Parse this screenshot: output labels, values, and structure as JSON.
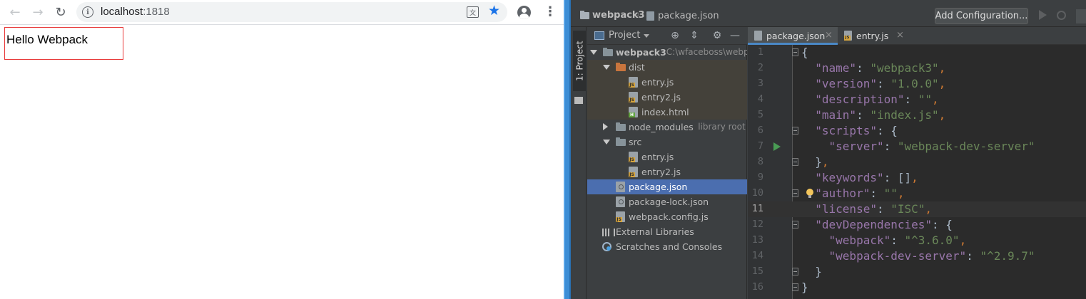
{
  "browser": {
    "url_host": "localhost",
    "url_port": ":1818",
    "page_text": "Hello Webpack"
  },
  "ide": {
    "breadcrumb_project": "webpack3",
    "breadcrumb_file": "package.json",
    "add_configuration_label": "Add Configuration...",
    "side_tab_label": "1: Project",
    "project_panel_title": "Project",
    "tree": [
      {
        "label": "webpack3",
        "hint": "C:\\wfaceboss\\webpa",
        "icon": "folder-icon",
        "indent": 0,
        "arrow": "open",
        "bold": true
      },
      {
        "label": "dist",
        "hint": "",
        "icon": "folder-icon-orange",
        "indent": 1,
        "arrow": "open"
      },
      {
        "label": "entry.js",
        "hint": "",
        "icon": "js-file-icon",
        "indent": 2,
        "arrow": ""
      },
      {
        "label": "entry2.js",
        "hint": "",
        "icon": "js-file-icon",
        "indent": 2,
        "arrow": ""
      },
      {
        "label": "index.html",
        "hint": "",
        "icon": "html-file-icon",
        "indent": 2,
        "arrow": ""
      },
      {
        "label": "node_modules",
        "hint": "library root",
        "icon": "folder-icon",
        "indent": 1,
        "arrow": "closed"
      },
      {
        "label": "src",
        "hint": "",
        "icon": "folder-icon",
        "indent": 1,
        "arrow": "open"
      },
      {
        "label": "entry.js",
        "hint": "",
        "icon": "js-file-icon",
        "indent": 2,
        "arrow": ""
      },
      {
        "label": "entry2.js",
        "hint": "",
        "icon": "js-file-icon",
        "indent": 2,
        "arrow": ""
      },
      {
        "label": "package.json",
        "hint": "",
        "icon": "json-file-icon",
        "indent": 1,
        "arrow": "",
        "selected": true
      },
      {
        "label": "package-lock.json",
        "hint": "",
        "icon": "json-file-icon",
        "indent": 1,
        "arrow": ""
      },
      {
        "label": "webpack.config.js",
        "hint": "",
        "icon": "js-file-icon",
        "indent": 1,
        "arrow": ""
      },
      {
        "label": "External Libraries",
        "hint": "",
        "icon": "library-icon",
        "indent": 0,
        "arrow": ""
      },
      {
        "label": "Scratches and Consoles",
        "hint": "",
        "icon": "scratches-icon",
        "indent": 0,
        "arrow": ""
      }
    ],
    "tabs": [
      {
        "label": "package.json",
        "active": true,
        "icon": "json-file-icon"
      },
      {
        "label": "entry.js",
        "active": false,
        "icon": "js-file-icon"
      }
    ],
    "code_lines": [
      [
        [
          "brace",
          "{"
        ]
      ],
      [
        [
          "sp",
          "  "
        ],
        [
          "key",
          "\"name\""
        ],
        [
          "plain",
          ": "
        ],
        [
          "str",
          "\"webpack3\""
        ],
        [
          "punc",
          ","
        ]
      ],
      [
        [
          "sp",
          "  "
        ],
        [
          "key",
          "\"version\""
        ],
        [
          "plain",
          ": "
        ],
        [
          "str",
          "\"1.0.0\""
        ],
        [
          "punc",
          ","
        ]
      ],
      [
        [
          "sp",
          "  "
        ],
        [
          "key",
          "\"description\""
        ],
        [
          "plain",
          ": "
        ],
        [
          "str",
          "\"\""
        ],
        [
          "punc",
          ","
        ]
      ],
      [
        [
          "sp",
          "  "
        ],
        [
          "key",
          "\"main\""
        ],
        [
          "plain",
          ": "
        ],
        [
          "str",
          "\"index.js\""
        ],
        [
          "punc",
          ","
        ]
      ],
      [
        [
          "sp",
          "  "
        ],
        [
          "key",
          "\"scripts\""
        ],
        [
          "plain",
          ": {"
        ]
      ],
      [
        [
          "sp",
          "    "
        ],
        [
          "key",
          "\"server\""
        ],
        [
          "plain",
          ": "
        ],
        [
          "str",
          "\"webpack-dev-server\""
        ]
      ],
      [
        [
          "sp",
          "  "
        ],
        [
          "plain",
          "}"
        ],
        [
          "punc",
          ","
        ]
      ],
      [
        [
          "sp",
          "  "
        ],
        [
          "key",
          "\"keywords\""
        ],
        [
          "plain",
          ": []"
        ],
        [
          "punc",
          ","
        ]
      ],
      [
        [
          "sp",
          "  "
        ],
        [
          "key",
          "\"author\""
        ],
        [
          "plain",
          ": "
        ],
        [
          "str",
          "\"\""
        ],
        [
          "punc",
          ","
        ]
      ],
      [
        [
          "sp",
          "  "
        ],
        [
          "key",
          "\"license\""
        ],
        [
          "plain",
          ": "
        ],
        [
          "str",
          "\"ISC\""
        ],
        [
          "punc",
          ","
        ]
      ],
      [
        [
          "sp",
          "  "
        ],
        [
          "key",
          "\"devDependencies\""
        ],
        [
          "plain",
          ": {"
        ]
      ],
      [
        [
          "sp",
          "    "
        ],
        [
          "key",
          "\"webpack\""
        ],
        [
          "plain",
          ": "
        ],
        [
          "str",
          "\"^3.6.0\""
        ],
        [
          "punc",
          ","
        ]
      ],
      [
        [
          "sp",
          "    "
        ],
        [
          "key",
          "\"webpack-dev-server\""
        ],
        [
          "plain",
          ": "
        ],
        [
          "str",
          "\"^2.9.7\""
        ]
      ],
      [
        [
          "sp",
          "  "
        ],
        [
          "plain",
          "}"
        ]
      ],
      [
        [
          "brace",
          "}"
        ]
      ]
    ],
    "current_line": 11,
    "fold_lines": [
      1,
      6,
      8,
      10,
      12,
      15,
      16
    ],
    "run_line": 7,
    "bulb_line": 10
  }
}
